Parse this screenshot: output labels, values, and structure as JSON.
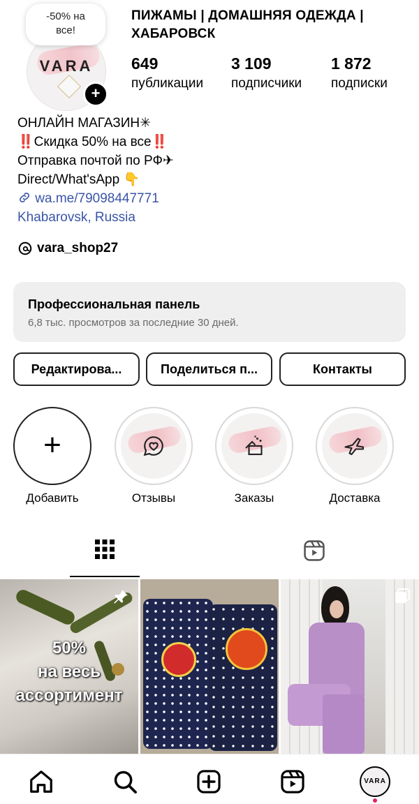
{
  "profile": {
    "avatar_logo": "VARA",
    "bubble_note": "-50% на все!",
    "title": "ПИЖАМЫ | ДОМАШНЯЯ ОДЕЖДА | ХАБАРОВСК",
    "stats": [
      {
        "value": "649",
        "label": "публикации"
      },
      {
        "value": "3 109",
        "label": "подписчики"
      },
      {
        "value": "1 872",
        "label": "подписки"
      }
    ]
  },
  "bio": {
    "line1": "ОНЛАЙН МАГАЗИН✳",
    "line2": "‼️Скидка 50% на все‼️",
    "line3": "Отправка почтой по РФ✈",
    "line4": "Direct/What'sApp 👇",
    "link": "wa.me/79098447771",
    "location": "Khabarovsk, Russia",
    "threads_handle": "vara_shop27"
  },
  "panel": {
    "title": "Профессиональная панель",
    "subtitle": "6,8 тыс. просмотров за последние 30 дней."
  },
  "actions": {
    "edit": "Редактирова...",
    "share": "Поделиться п...",
    "contacts": "Контакты"
  },
  "highlights": [
    {
      "label": "Добавить",
      "icon": "plus-icon"
    },
    {
      "label": "Отзывы",
      "icon": "chat-heart-icon"
    },
    {
      "label": "Заказы",
      "icon": "gift-box-icon"
    },
    {
      "label": "Доставка",
      "icon": "airplane-icon"
    }
  ],
  "tabs": [
    "grid-icon",
    "reels-icon"
  ],
  "posts": [
    {
      "caption": "50%\nна весь\nассортимент",
      "pinned": true
    },
    {
      "caption": ""
    },
    {
      "caption": "",
      "multi": true
    }
  ],
  "nav": {
    "items": [
      "home-icon",
      "search-icon",
      "create-icon",
      "reels-icon",
      "profile-avatar"
    ],
    "avatar_text": "VARA"
  },
  "colors": {
    "link": "#3a55a8",
    "panel_bg": "#efefef",
    "accent_pink": "#f2b9c0"
  }
}
